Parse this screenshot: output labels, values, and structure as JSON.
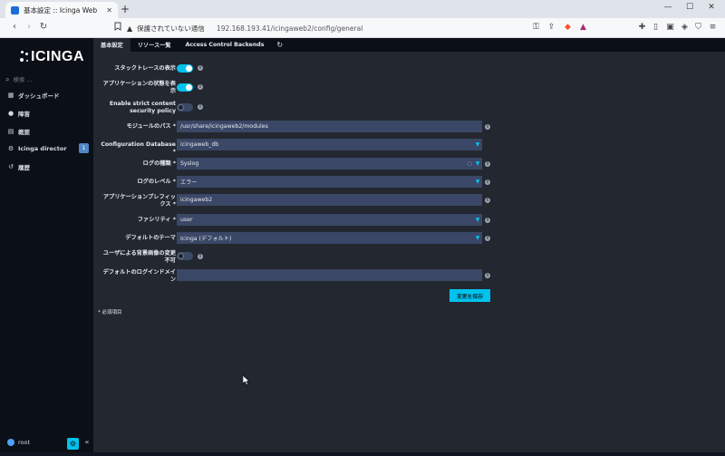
{
  "browser": {
    "tab_title": "基本設定 :: Icinga Web",
    "tab_close": "✕",
    "new_tab": "+",
    "window_controls": {
      "minimize": "—",
      "maximize": "☐",
      "close": "✕"
    },
    "nav": {
      "back": "‹",
      "forward": "›",
      "reload": "↻"
    },
    "security_warning": "保護されていない通信",
    "url": "192.168.193.41/icingaweb2/config/general"
  },
  "sidebar": {
    "logo_text": "icinga",
    "search_placeholder": "検索 ...",
    "items": [
      {
        "label": "ダッシュボード",
        "icon": "dashboard-icon",
        "glyph": "▦"
      },
      {
        "label": "障害",
        "icon": "problems-icon",
        "glyph": "●"
      },
      {
        "label": "概要",
        "icon": "overview-icon",
        "glyph": "▤"
      },
      {
        "label": "Icinga director",
        "icon": "director-icon",
        "glyph": "⚙",
        "badge": "1"
      },
      {
        "label": "履歴",
        "icon": "history-icon",
        "glyph": "↺"
      }
    ],
    "user": "root",
    "settings_glyph": "⚙",
    "collapse_glyph": "«"
  },
  "tabs": [
    {
      "label": "基本設定",
      "active": true
    },
    {
      "label": "リソース一覧",
      "active": false
    },
    {
      "label": "Access Control Backends",
      "active": false
    }
  ],
  "refresh_glyph": "↻",
  "form": {
    "show_stacktraces": {
      "label": "スタックトレースの表示",
      "enabled": true
    },
    "show_app_state": {
      "label": "アプリケーションの状態を表示",
      "enabled": true
    },
    "strict_csp": {
      "label": "Enable strict content security policy",
      "enabled": false
    },
    "module_path": {
      "label": "モジュールのパス *",
      "value": "/usr/share/icingaweb2/modules"
    },
    "config_db": {
      "label": "Configuration Database *",
      "value": "icingaweb_db"
    },
    "log_type": {
      "label": "ログの種類 *",
      "value": "Syslog"
    },
    "log_level": {
      "label": "ログのレベル *",
      "value": "エラー"
    },
    "app_prefix": {
      "label": "アプリケーションプレフィックス *",
      "value": "icingaweb2"
    },
    "facility": {
      "label": "ファシリティ *",
      "value": "user"
    },
    "default_theme": {
      "label": "デフォルトのテーマ",
      "value": "Icinga (デフォルト)"
    },
    "user_bg_image": {
      "label": "ユーザによる背景画像の変更不可",
      "enabled": false
    },
    "default_login_domain": {
      "label": "デフォルトのログインドメイン",
      "value": ""
    },
    "save_label": "変更を保存",
    "required_note": "* 必須項目"
  },
  "colors": {
    "accent": "#00c3ed",
    "sidebar_bg": "#0b0f17",
    "main_bg": "#23272f",
    "field_bg": "#3a4766"
  }
}
